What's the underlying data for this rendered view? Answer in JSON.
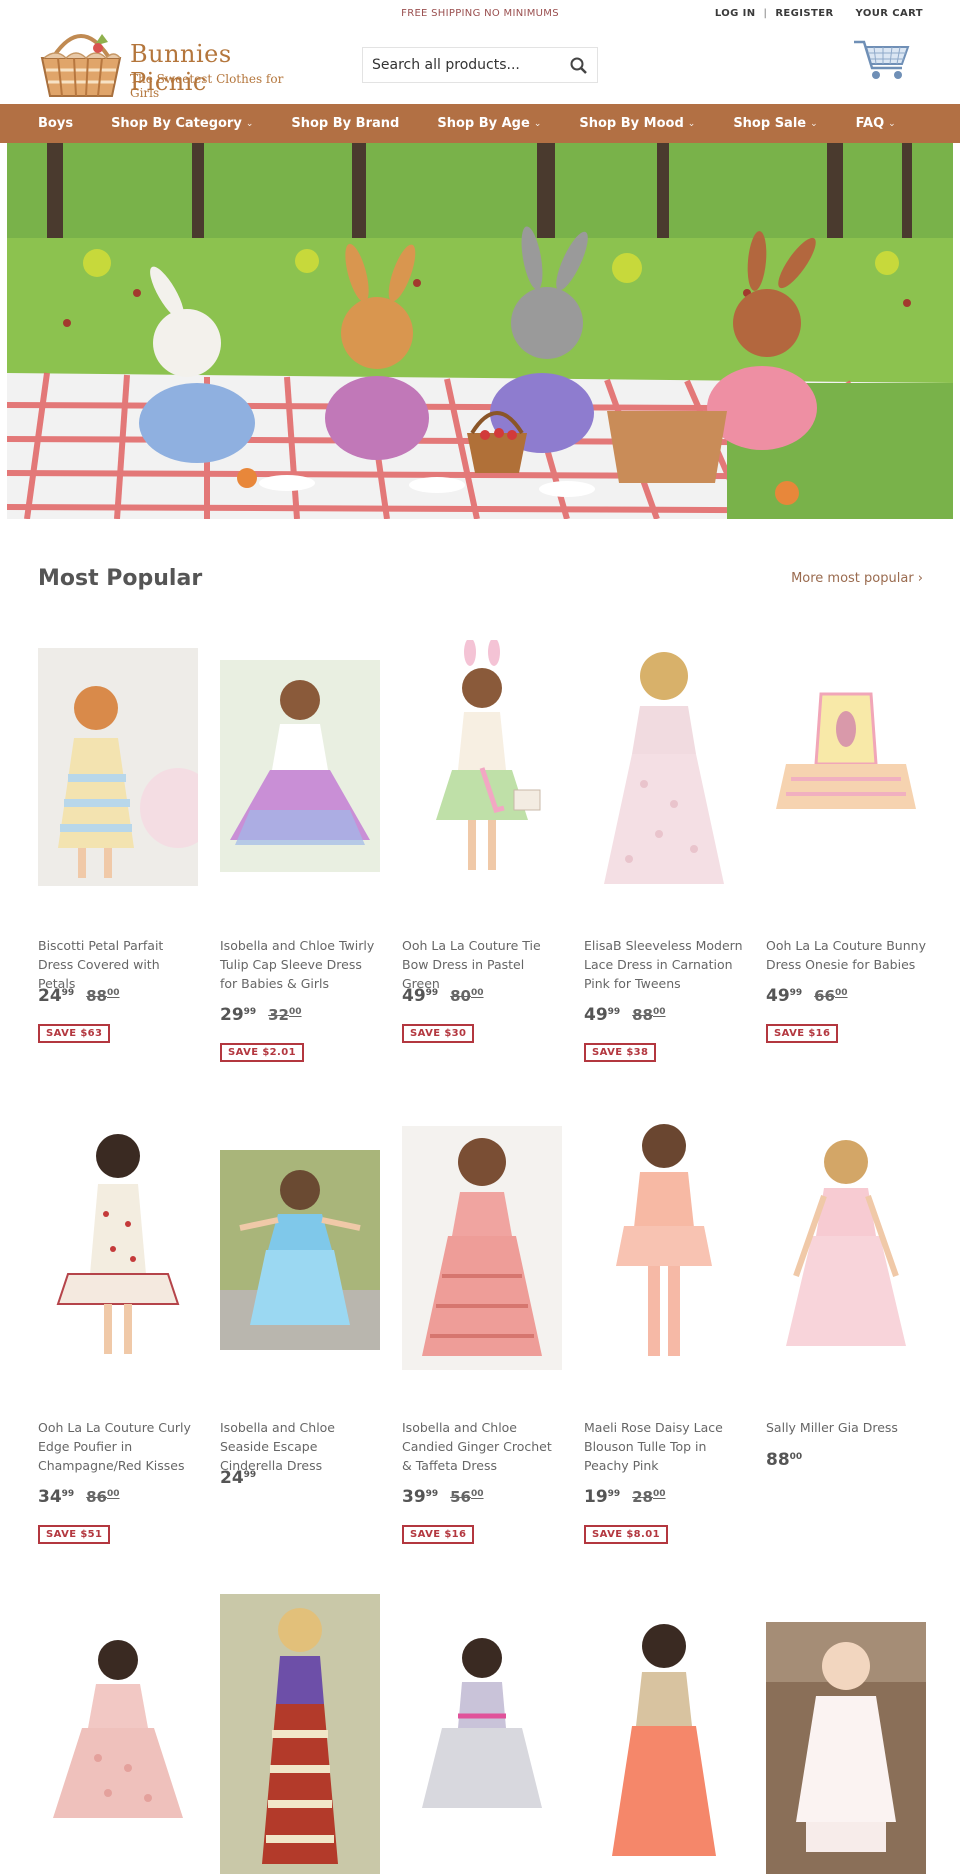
{
  "topbar": {
    "promo": "FREE SHIPPING NO MINIMUMS",
    "login": "LOG IN",
    "separator": "|",
    "register": "REGISTER",
    "cart": "YOUR CART"
  },
  "brand": {
    "name": "Bunnies Picnic",
    "tagline": "The Sweetest Clothes for Girls",
    "color": "#b4763c"
  },
  "search": {
    "placeholder": "Search all products..."
  },
  "nav": {
    "color": "#b27044",
    "items": [
      {
        "label": "Boys"
      },
      {
        "label": "Shop By Category"
      },
      {
        "label": "Shop By Brand"
      },
      {
        "label": "Shop By Age"
      },
      {
        "label": "Shop By Mood"
      },
      {
        "label": "Shop Sale"
      },
      {
        "label": "FAQ"
      }
    ]
  },
  "section": {
    "title": "Most Popular",
    "more": "More most popular ›"
  },
  "products": [
    {
      "name": "Biscotti Petal Parfait Dress Covered with Petals",
      "price_main": "24",
      "price_cents": "99",
      "was_main": "88",
      "was_cents": "00",
      "save": "SAVE $63"
    },
    {
      "name": "Isobella and Chloe Twirly Tulip Cap Sleeve Dress for Babies & Girls",
      "price_main": "29",
      "price_cents": "99",
      "was_main": "32",
      "was_cents": "00",
      "save": "SAVE $2.01"
    },
    {
      "name": "Ooh La La Couture Tie Bow Dress in Pastel Green",
      "price_main": "49",
      "price_cents": "99",
      "was_main": "80",
      "was_cents": "00",
      "save": "SAVE $30"
    },
    {
      "name": "ElisaB Sleeveless Modern Lace Dress in Carnation Pink for Tweens",
      "price_main": "49",
      "price_cents": "99",
      "was_main": "88",
      "was_cents": "00",
      "save": "SAVE $38"
    },
    {
      "name": "Ooh La La Couture Bunny Dress Onesie for Babies",
      "price_main": "49",
      "price_cents": "99",
      "was_main": "66",
      "was_cents": "00",
      "save": "SAVE $16"
    },
    {
      "name": "Ooh La La Couture Curly Edge Poufier in Champagne/Red Kisses",
      "price_main": "34",
      "price_cents": "99",
      "was_main": "86",
      "was_cents": "00",
      "save": "SAVE $51"
    },
    {
      "name": "Isobella and Chloe Seaside Escape Cinderella Dress",
      "price_main": "24",
      "price_cents": "99"
    },
    {
      "name": "Isobella and Chloe Candied Ginger Crochet & Taffeta Dress",
      "price_main": "39",
      "price_cents": "99",
      "was_main": "56",
      "was_cents": "00",
      "save": "SAVE $16"
    },
    {
      "name": "Maeli Rose Daisy Lace Blouson Tulle Top in Peachy Pink",
      "price_main": "19",
      "price_cents": "99",
      "was_main": "28",
      "was_cents": "00",
      "save": "SAVE $8.01"
    },
    {
      "name": "Sally Miller Gia Dress",
      "price_main": "88",
      "price_cents": "00"
    }
  ]
}
